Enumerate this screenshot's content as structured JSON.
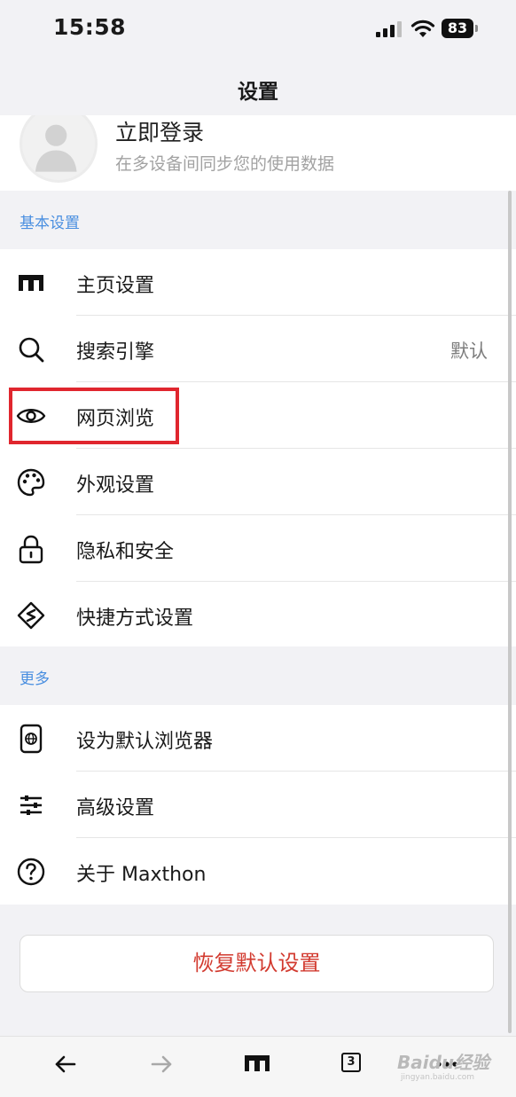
{
  "status_bar": {
    "time": "15:58",
    "battery": "83"
  },
  "nav": {
    "title": "设置"
  },
  "profile": {
    "login": "立即登录",
    "subtitle": "在多设备间同步您的使用数据"
  },
  "sections": {
    "basic": {
      "header": "基本设置",
      "items": [
        {
          "label": "主页设置",
          "icon": "home-icon"
        },
        {
          "label": "搜索引擎",
          "value": "默认",
          "icon": "search-icon"
        },
        {
          "label": "网页浏览",
          "icon": "eye-icon"
        },
        {
          "label": "外观设置",
          "icon": "palette-icon"
        },
        {
          "label": "隐私和安全",
          "icon": "lock-icon"
        },
        {
          "label": "快捷方式设置",
          "icon": "shortcut-icon"
        }
      ]
    },
    "more": {
      "header": "更多",
      "items": [
        {
          "label": "设为默认浏览器",
          "icon": "phone-globe-icon"
        },
        {
          "label": "高级设置",
          "icon": "sliders-icon"
        },
        {
          "label": "关于 Maxthon",
          "icon": "help-icon"
        }
      ]
    }
  },
  "restore_button": "恢复默认设置",
  "toolbar": {
    "tab_count": "3",
    "icons": [
      "back-icon",
      "forward-icon",
      "home-icon",
      "tabs-icon",
      "more-icon"
    ]
  },
  "watermark": {
    "main": "Baidu经验",
    "sub": "jingyan.baidu.com"
  },
  "colors": {
    "accent_blue": "#4a8fe0",
    "highlight_red": "#e0262e",
    "restore_red": "#d23a2f"
  }
}
